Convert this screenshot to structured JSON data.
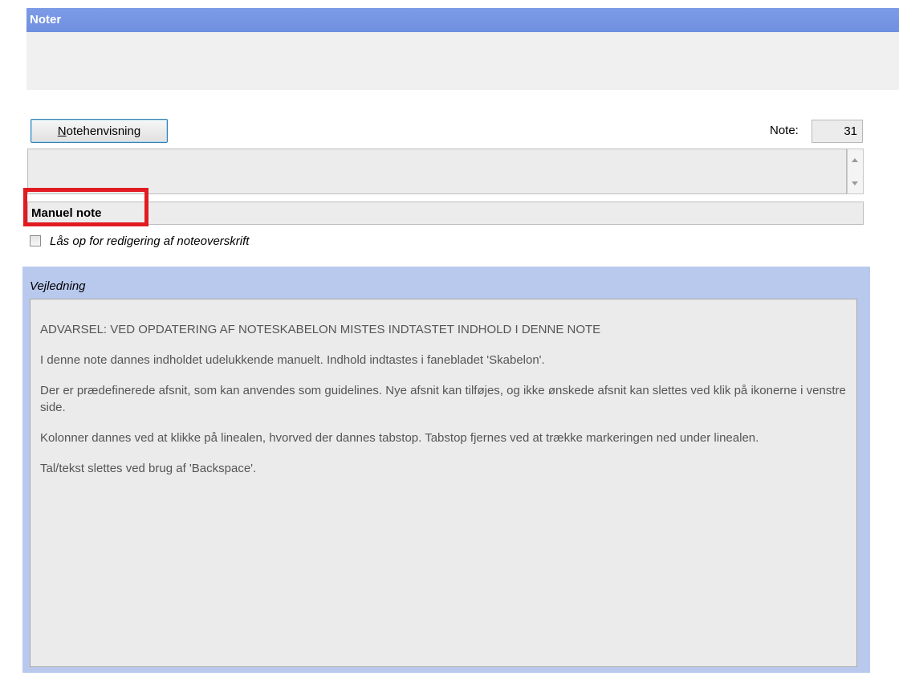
{
  "window": {
    "title": "Noter"
  },
  "toolbar": {
    "noteref_button_label": "Notehenvisning",
    "note_label": "Note:",
    "note_number": "31"
  },
  "manual_note": {
    "value": "Manuel note"
  },
  "unlock": {
    "label": "Lås op for redigering af noteoverskrift",
    "checked": false
  },
  "guide": {
    "title": "Vejledning",
    "paragraphs": [
      "ADVARSEL: VED OPDATERING AF NOTESKABELON MISTES INDTASTET INDHOLD I DENNE NOTE",
      "I denne note dannes indholdet udelukkende manuelt. Indhold indtastes i fanebladet 'Skabelon'.",
      "Der er prædefinerede afsnit, som kan anvendes som guidelines. Nye afsnit kan tilføjes, og ikke ønskede afsnit kan slettes ved klik på ikonerne i venstre side.",
      "Kolonner dannes ved at klikke på linealen, hvorved der dannes tabstop. Tabstop fjernes ved at trække markeringen ned under linealen.",
      "Tal/tekst slettes ved brug af 'Backspace'."
    ]
  },
  "colors": {
    "title_bar": "#7d9be6",
    "guide_panel": "#b9c9ee",
    "highlight": "#e11b22"
  }
}
